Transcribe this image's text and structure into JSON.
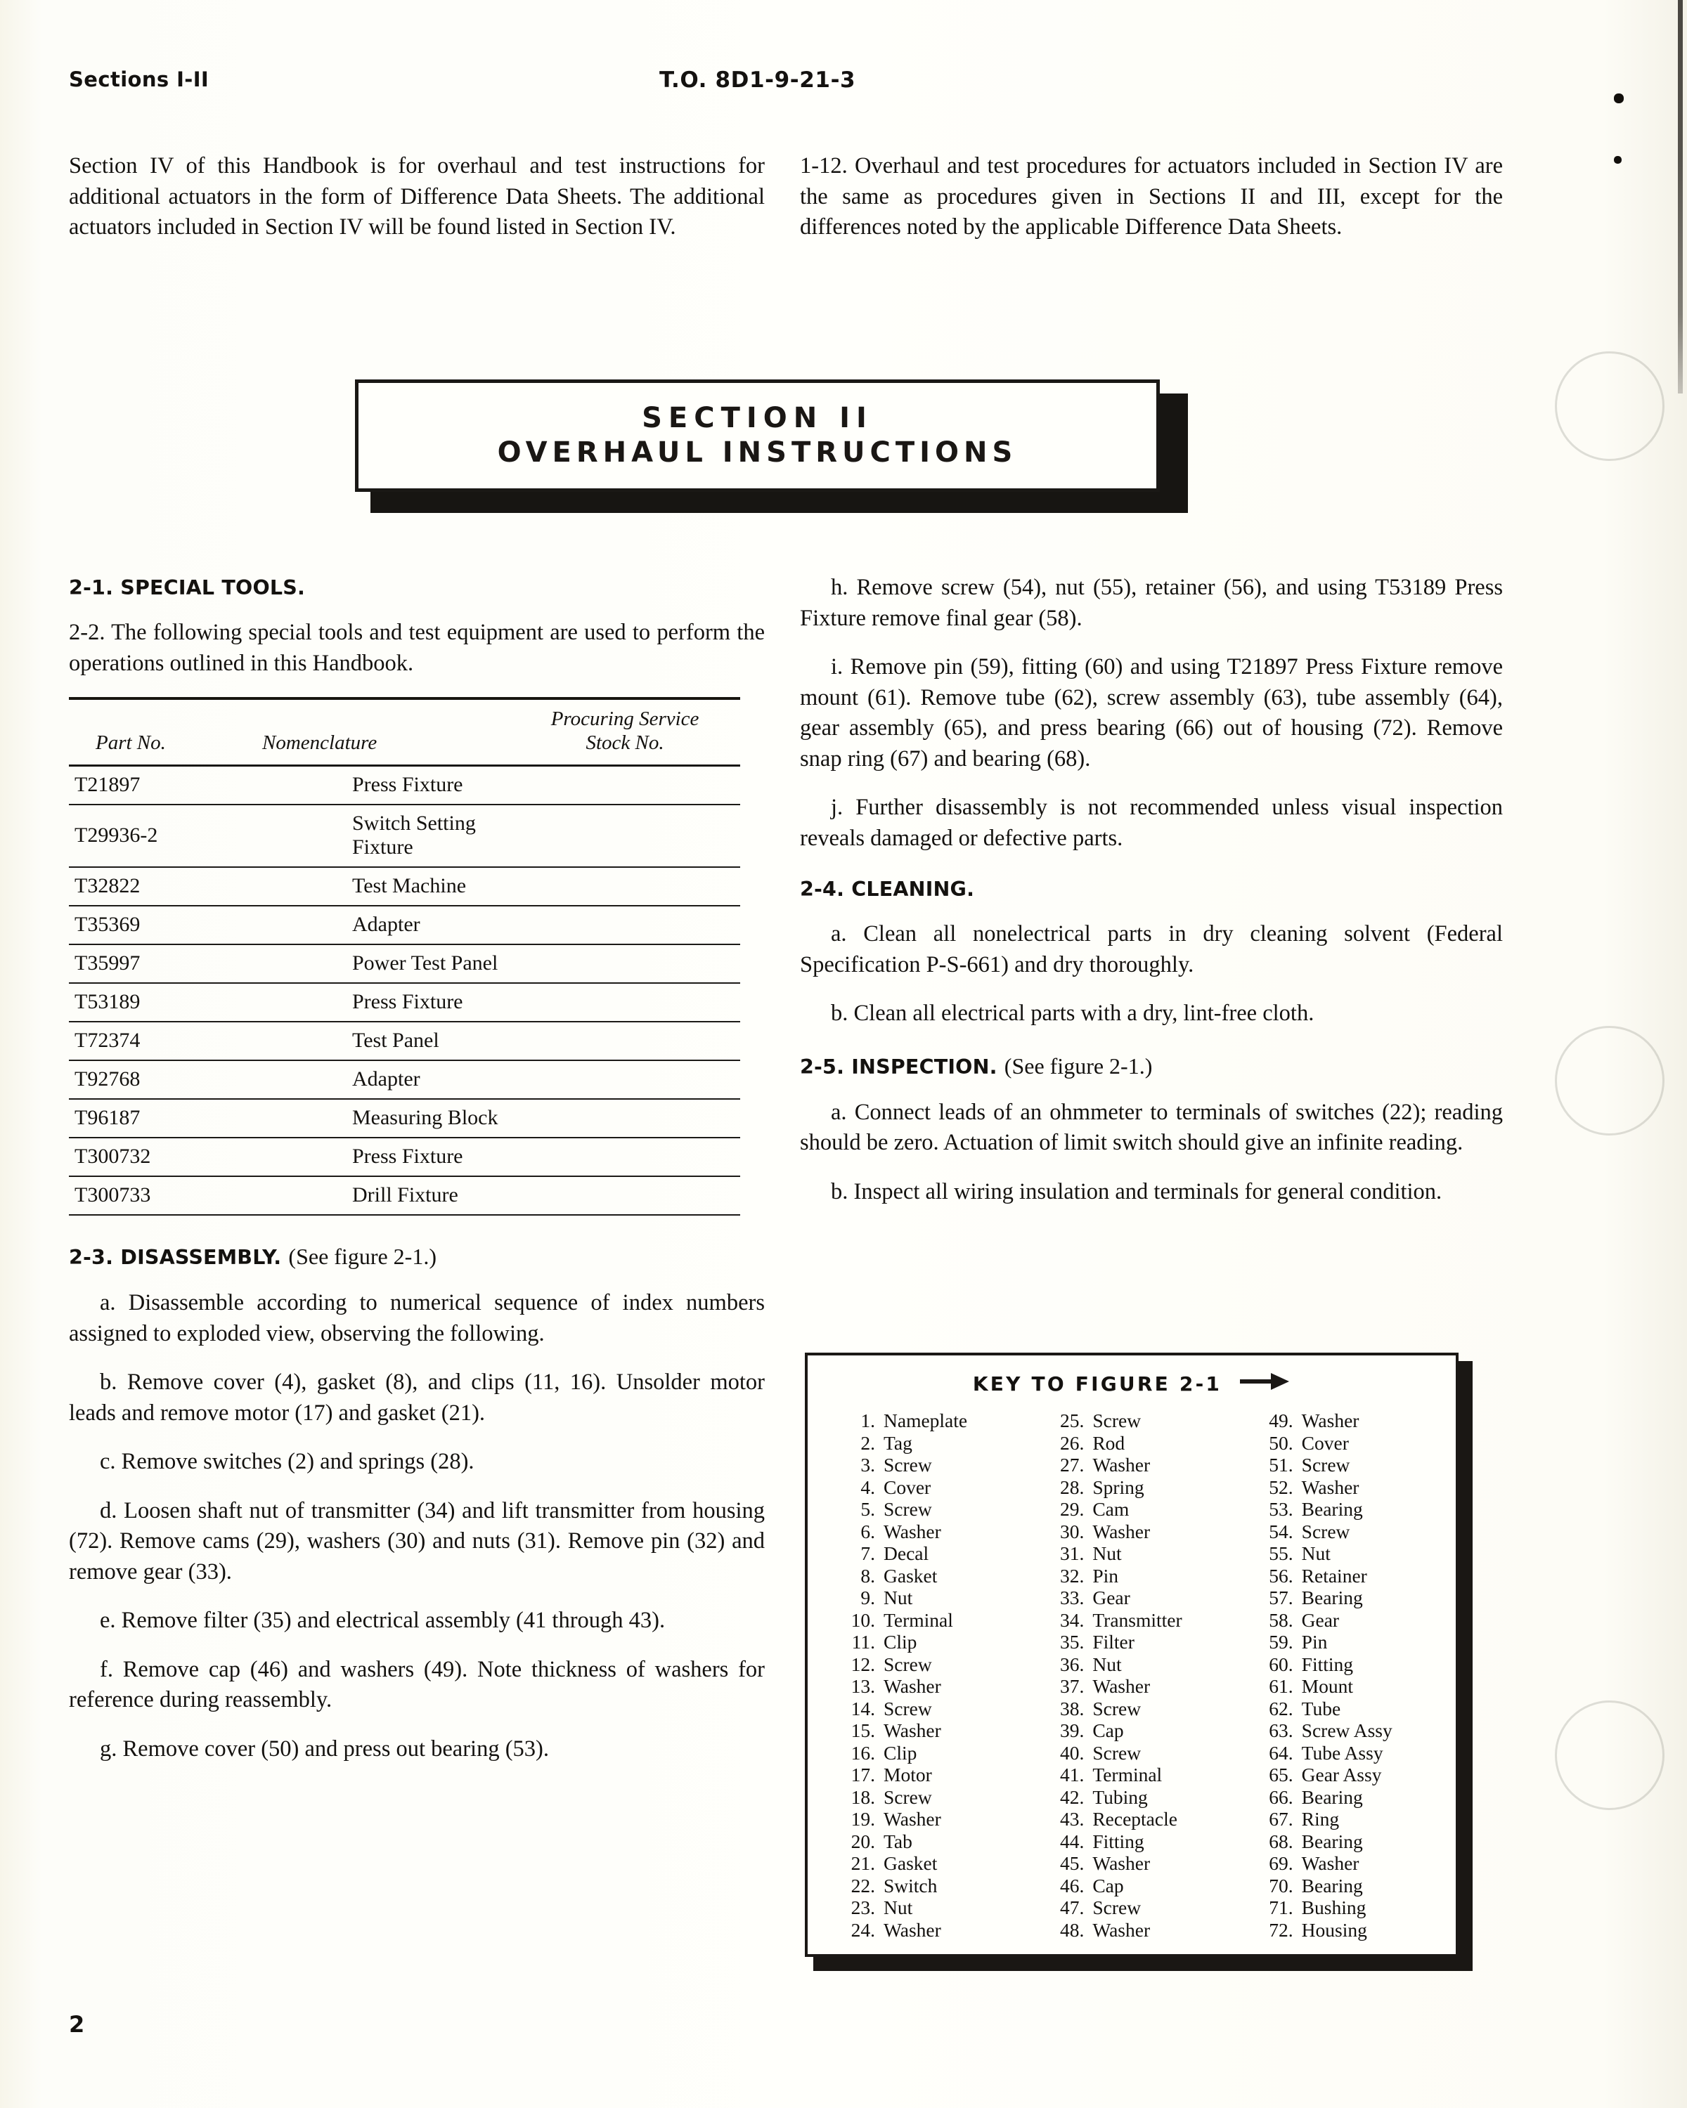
{
  "running_head": {
    "left": "Sections I-II",
    "center": "T.O. 8D1-9-21-3"
  },
  "banner": {
    "line1": "SECTION II",
    "line2": "OVERHAUL INSTRUCTIONS"
  },
  "left_column": {
    "intro_paragraph": "Section IV of this Handbook is for overhaul and test instructions for additional actuators in the form of Difference Data Sheets. The additional actuators included in Section IV will be found listed in Section IV.",
    "special_tools_heading": "2-1. SPECIAL TOOLS.",
    "para_2_2": "2-2. The following special tools and test equipment are used to perform the operations outlined in this Handbook.",
    "disassembly_heading_num": "2-3. DISASSEMBLY.",
    "disassembly_heading_tail": "(See figure 2-1.)",
    "disassembly_items": [
      "a. Disassemble according to numerical sequence of index numbers assigned to exploded view, observing the following.",
      "b. Remove cover (4), gasket (8), and clips (11, 16). Unsolder motor leads and remove motor (17) and gasket (21).",
      "c. Remove switches (2) and springs (28).",
      "d. Loosen shaft nut of transmitter (34) and lift transmitter from housing (72). Remove cams (29), washers (30) and nuts (31). Remove pin (32) and remove gear (33).",
      "e. Remove filter (35) and electrical assembly (41 through 43).",
      "f. Remove cap (46) and washers (49). Note thickness of washers for reference during reassembly.",
      "g. Remove cover (50) and press out bearing (53)."
    ]
  },
  "tools_table": {
    "headers": {
      "part_no": "Part No.",
      "nomenclature": "Nomenclature",
      "stock_no_line1": "Procuring Service",
      "stock_no_line2": "Stock No."
    },
    "rows": [
      {
        "part_no": "T21897",
        "nomenclature": "Press Fixture",
        "stock_no": ""
      },
      {
        "part_no": "T29936-2",
        "nomenclature": "Switch Setting Fixture",
        "stock_no": ""
      },
      {
        "part_no": "T32822",
        "nomenclature": "Test Machine",
        "stock_no": ""
      },
      {
        "part_no": "T35369",
        "nomenclature": "Adapter",
        "stock_no": ""
      },
      {
        "part_no": "T35997",
        "nomenclature": "Power Test Panel",
        "stock_no": ""
      },
      {
        "part_no": "T53189",
        "nomenclature": "Press Fixture",
        "stock_no": ""
      },
      {
        "part_no": "T72374",
        "nomenclature": "Test Panel",
        "stock_no": ""
      },
      {
        "part_no": "T92768",
        "nomenclature": "Adapter",
        "stock_no": ""
      },
      {
        "part_no": "T96187",
        "nomenclature": "Measuring Block",
        "stock_no": ""
      },
      {
        "part_no": "T300732",
        "nomenclature": "Press Fixture",
        "stock_no": ""
      },
      {
        "part_no": "T300733",
        "nomenclature": "Drill Fixture",
        "stock_no": ""
      }
    ]
  },
  "right_column": {
    "para_1_12": "1-12. Overhaul and test procedures for actuators included in Section IV are the same as procedures given in Sections II and III, except for the differences noted by the applicable Difference Data Sheets.",
    "disassembly_items": [
      "h. Remove screw (54), nut (55), retainer (56), and using T53189 Press Fixture remove final gear (58).",
      "i. Remove pin (59), fitting (60) and using T21897 Press Fixture remove mount (61). Remove tube (62), screw assembly (63), tube assembly (64), gear assembly (65), and press bearing (66) out of housing (72). Remove snap ring (67) and bearing (68).",
      "j. Further disassembly is not recommended unless visual inspection reveals damaged or defective parts."
    ],
    "cleaning_heading": "2-4. CLEANING.",
    "cleaning_items": [
      "a. Clean all nonelectrical parts in dry cleaning solvent (Federal Specification P-S-661) and dry thoroughly.",
      "b. Clean all electrical parts with a dry, lint-free cloth."
    ],
    "inspection_heading_num": "2-5. INSPECTION.",
    "inspection_heading_tail": "(See figure 2-1.)",
    "inspection_items": [
      "a. Connect leads of an ohmmeter to terminals of switches (22); reading should be zero. Actuation of limit switch should give an infinite reading.",
      "b. Inspect all wiring insulation and terminals for general condition."
    ]
  },
  "key_to_figure": {
    "title": "KEY TO FIGURE 2-1",
    "arrow_icon": "right-arrow-icon",
    "columns": [
      [
        {
          "num": "1.",
          "label": "Nameplate"
        },
        {
          "num": "2.",
          "label": "Tag"
        },
        {
          "num": "3.",
          "label": "Screw"
        },
        {
          "num": "4.",
          "label": "Cover"
        },
        {
          "num": "5.",
          "label": "Screw"
        },
        {
          "num": "6.",
          "label": "Washer"
        },
        {
          "num": "7.",
          "label": "Decal"
        },
        {
          "num": "8.",
          "label": "Gasket"
        },
        {
          "num": "9.",
          "label": "Nut"
        },
        {
          "num": "10.",
          "label": "Terminal"
        },
        {
          "num": "11.",
          "label": "Clip"
        },
        {
          "num": "12.",
          "label": "Screw"
        },
        {
          "num": "13.",
          "label": "Washer"
        },
        {
          "num": "14.",
          "label": "Screw"
        },
        {
          "num": "15.",
          "label": "Washer"
        },
        {
          "num": "16.",
          "label": "Clip"
        },
        {
          "num": "17.",
          "label": "Motor"
        },
        {
          "num": "18.",
          "label": "Screw"
        },
        {
          "num": "19.",
          "label": "Washer"
        },
        {
          "num": "20.",
          "label": "Tab"
        },
        {
          "num": "21.",
          "label": "Gasket"
        },
        {
          "num": "22.",
          "label": "Switch"
        },
        {
          "num": "23.",
          "label": "Nut"
        },
        {
          "num": "24.",
          "label": "Washer"
        }
      ],
      [
        {
          "num": "25.",
          "label": "Screw"
        },
        {
          "num": "26.",
          "label": "Rod"
        },
        {
          "num": "27.",
          "label": "Washer"
        },
        {
          "num": "28.",
          "label": "Spring"
        },
        {
          "num": "29.",
          "label": "Cam"
        },
        {
          "num": "30.",
          "label": "Washer"
        },
        {
          "num": "31.",
          "label": "Nut"
        },
        {
          "num": "32.",
          "label": "Pin"
        },
        {
          "num": "33.",
          "label": "Gear"
        },
        {
          "num": "34.",
          "label": "Transmitter"
        },
        {
          "num": "35.",
          "label": "Filter"
        },
        {
          "num": "36.",
          "label": "Nut"
        },
        {
          "num": "37.",
          "label": "Washer"
        },
        {
          "num": "38.",
          "label": "Screw"
        },
        {
          "num": "39.",
          "label": "Cap"
        },
        {
          "num": "40.",
          "label": "Screw"
        },
        {
          "num": "41.",
          "label": "Terminal"
        },
        {
          "num": "42.",
          "label": "Tubing"
        },
        {
          "num": "43.",
          "label": "Receptacle"
        },
        {
          "num": "44.",
          "label": "Fitting"
        },
        {
          "num": "45.",
          "label": "Washer"
        },
        {
          "num": "46.",
          "label": "Cap"
        },
        {
          "num": "47.",
          "label": "Screw"
        },
        {
          "num": "48.",
          "label": "Washer"
        }
      ],
      [
        {
          "num": "49.",
          "label": "Washer"
        },
        {
          "num": "50.",
          "label": "Cover"
        },
        {
          "num": "51.",
          "label": "Screw"
        },
        {
          "num": "52.",
          "label": "Washer"
        },
        {
          "num": "53.",
          "label": "Bearing"
        },
        {
          "num": "54.",
          "label": "Screw"
        },
        {
          "num": "55.",
          "label": "Nut"
        },
        {
          "num": "56.",
          "label": "Retainer"
        },
        {
          "num": "57.",
          "label": "Bearing"
        },
        {
          "num": "58.",
          "label": "Gear"
        },
        {
          "num": "59.",
          "label": "Pin"
        },
        {
          "num": "60.",
          "label": "Fitting"
        },
        {
          "num": "61.",
          "label": "Mount"
        },
        {
          "num": "62.",
          "label": "Tube"
        },
        {
          "num": "63.",
          "label": "Screw Assy"
        },
        {
          "num": "64.",
          "label": "Tube Assy"
        },
        {
          "num": "65.",
          "label": "Gear Assy"
        },
        {
          "num": "66.",
          "label": "Bearing"
        },
        {
          "num": "67.",
          "label": "Ring"
        },
        {
          "num": "68.",
          "label": "Bearing"
        },
        {
          "num": "69.",
          "label": "Washer"
        },
        {
          "num": "70.",
          "label": "Bearing"
        },
        {
          "num": "71.",
          "label": "Bushing"
        },
        {
          "num": "72.",
          "label": "Housing"
        }
      ]
    ]
  },
  "page_number": "2"
}
